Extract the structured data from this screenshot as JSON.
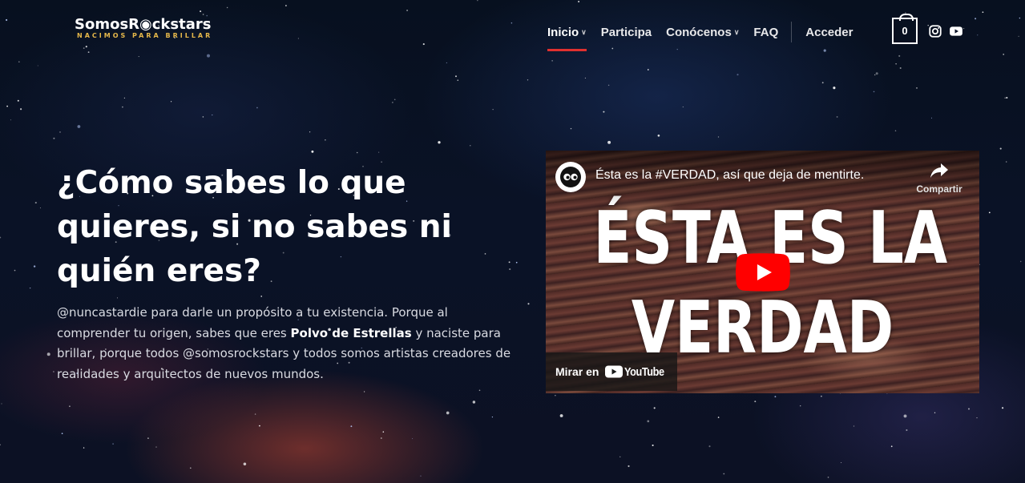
{
  "header": {
    "logo_main": "SomosR◉ckstars",
    "logo_tagline": "NACIMOS PARA BRILLAR",
    "nav": [
      {
        "label": "Inicio",
        "dropdown": true,
        "active": true
      },
      {
        "label": "Participa",
        "dropdown": false,
        "active": false
      },
      {
        "label": "Conócenos",
        "dropdown": true,
        "active": false
      },
      {
        "label": "FAQ",
        "dropdown": false,
        "active": false
      }
    ],
    "login_label": "Acceder",
    "cart_count": "0",
    "social_icons": [
      "instagram-icon",
      "youtube-icon"
    ]
  },
  "hero": {
    "title": "¿Cómo sabes lo que quieres, si no sabes ni quién eres?",
    "text_before": "@nuncastardie para darle un propósito a tu existencia. Porque al comprender tu origen, sabes que eres ",
    "text_bold": "Polvo de Estrellas",
    "text_after": " y naciste para brillar, porque todos @somosrockstars y todos somos artistas creadores de realidades y arquitectos de nuevos mundos."
  },
  "video": {
    "title": "Ésta es la #VERDAD, así que deja de mentirte.",
    "share_label": "Compartir",
    "thumbnail_line1": "ÉSTA ES LA",
    "thumbnail_line2": "VERDAD",
    "watch_on_label": "Mirar en",
    "youtube_wordmark": "YouTube"
  },
  "colors": {
    "accent_red": "#e0302f",
    "tagline_gold": "#e6b84a",
    "youtube_red": "#ff0000"
  }
}
